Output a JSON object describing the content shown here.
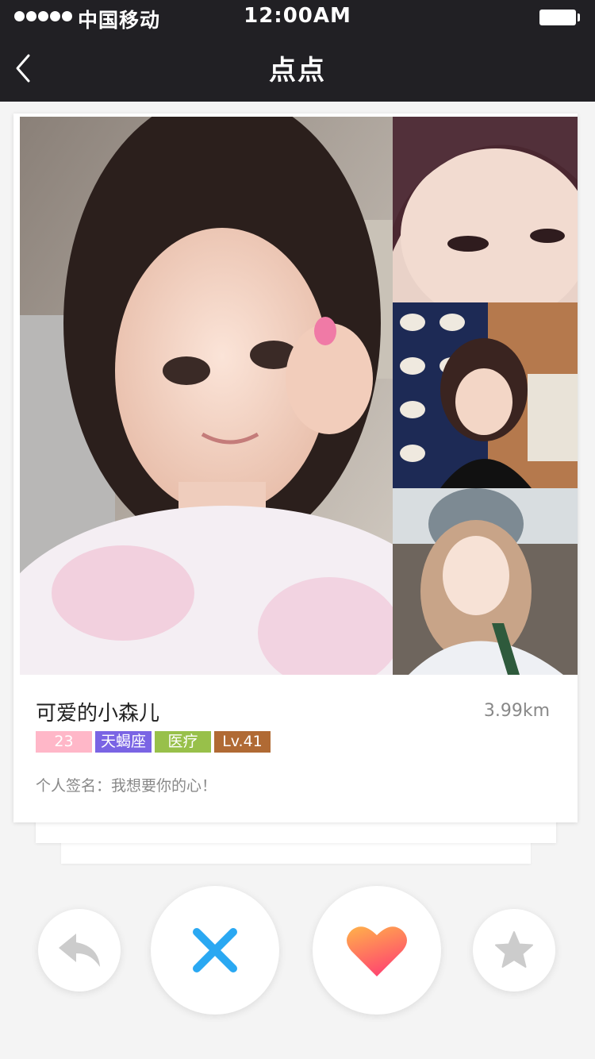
{
  "status_bar": {
    "carrier": "中国移动",
    "time": "12:00AM"
  },
  "nav": {
    "title": "点点",
    "back_icon": "chevron-left-icon"
  },
  "profile": {
    "name": "可爱的小森儿",
    "distance": "3.99km",
    "tags": {
      "age": "23",
      "zodiac": "天蝎座",
      "job": "医疗",
      "level": "Lv.41"
    },
    "signature": "个人签名：我想要你的心！"
  },
  "actions": {
    "undo_icon": "undo-arrow-icon",
    "dislike_icon": "x-icon",
    "like_icon": "heart-icon",
    "star_icon": "star-icon"
  },
  "colors": {
    "nav_bg": "#212024",
    "tag_age": "#ffb7c8",
    "tag_zodiac": "#7a64e4",
    "tag_job": "#98c04a",
    "tag_level": "#b06a34",
    "dislike_blue": "#2aa8f2",
    "like_gradient_start": "#ffb24a",
    "like_gradient_end": "#ff4a6e"
  }
}
